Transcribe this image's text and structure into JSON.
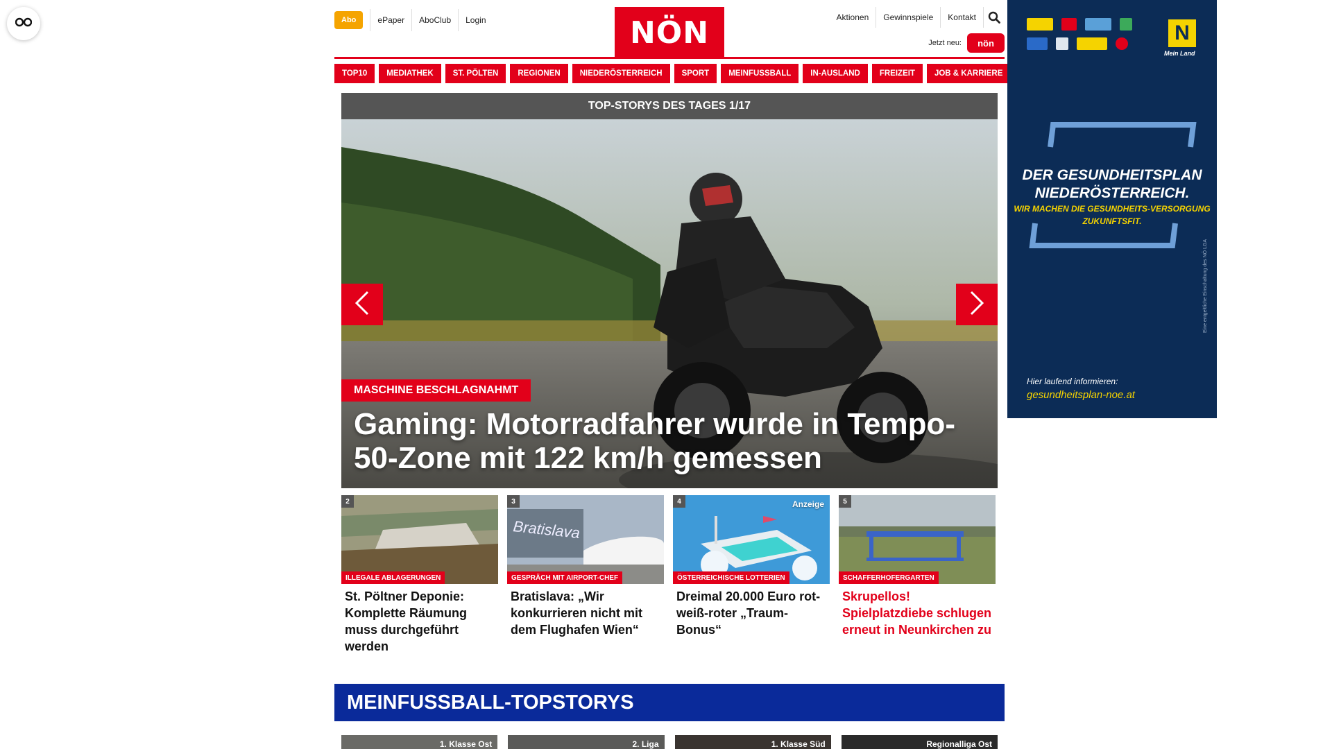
{
  "header": {
    "abo": "Abo",
    "left_links": [
      "ePaper",
      "AboClub",
      "Login"
    ],
    "logo": "NÖN",
    "right_links": [
      "Aktionen",
      "Gewinnspiele",
      "Kontakt"
    ],
    "jetzt_neu": "Jetzt neu:",
    "jetzt_badge": "nön"
  },
  "nav": [
    "TOP10",
    "MEDIATHEK",
    "ST. PÖLTEN",
    "REGIONEN",
    "NIEDERÖSTERREICH",
    "SPORT",
    "MEINFUSSBALL",
    "IN-AUSLAND",
    "FREIZEIT",
    "JOB & KARRIERE"
  ],
  "topstories": {
    "bar": "TOP-STORYS DES TAGES 1/17",
    "hero_kicker": "MASCHINE BESCHLAGNAHMT",
    "hero_title": "Gaming: Motorradfahrer wurde in Tempo-50-Zone mit 122 km/h gemessen"
  },
  "cards": [
    {
      "num": "2",
      "kicker": "ILLEGALE ABLAGERUNGEN",
      "title": "St. Pöltner Deponie: Komplette Räumung muss durchgeführt werden",
      "ad": ""
    },
    {
      "num": "3",
      "kicker": "GESPRÄCH MIT AIRPORT-CHEF",
      "title": "Bratislava: „Wir konkurrieren nicht mit dem Flughafen Wien“",
      "ad": ""
    },
    {
      "num": "4",
      "kicker": "ÖSTERREICHISCHE LOTTERIEN",
      "title": "Dreimal 20.000 Euro rot-weiß-roter „Traum-Bonus“",
      "ad": "Anzeige"
    },
    {
      "num": "5",
      "kicker": "SCHAFFERHOFERGARTEN",
      "title": "Skrupellos! Spielplatzdiebe schlugen erneut in Neunkirchen zu",
      "ad": ""
    }
  ],
  "meinfussball": {
    "bar": "MEINFUSSBALL-TOPSTORYS",
    "labels": [
      "1. Klasse Ost",
      "2. Liga",
      "1. Klasse Süd",
      "Regionalliga Ost"
    ]
  },
  "ad": {
    "headline": "DER GESUNDHEITSPLAN NIEDERÖSTERREICH.",
    "subline": "WIR MACHEN DIE GESUNDHEITS-VERSORGUNG ZUKUNFTSFIT.",
    "info": "Hier laufend informieren:",
    "url": "gesundheitsplan-noe.at",
    "mein_land": "Mein Land",
    "vertical": "Eine entgeltliche Einschaltung des NÖ LGA"
  },
  "colors": {
    "accent": "#e2001a",
    "abo": "#f5a400",
    "fussball": "#0a2a9a",
    "ad_bg": "#0c2c56",
    "ad_yellow": "#f5d300"
  },
  "icons": [
    "reader-icon",
    "search-icon",
    "chevron-left-icon",
    "chevron-right-icon"
  ]
}
